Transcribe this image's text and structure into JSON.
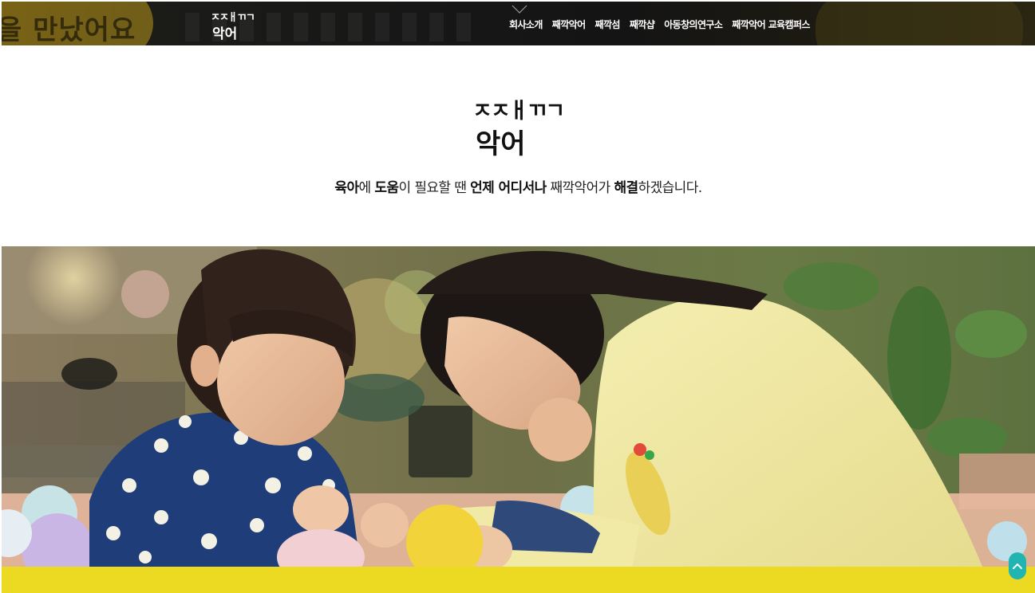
{
  "header": {
    "background_text": "을 만났어요",
    "logo": {
      "line1": "ㅈㅈㅐㄲㄱ",
      "line2": "악어"
    },
    "nav": [
      {
        "label": "회사소개"
      },
      {
        "label": "째깍악어"
      },
      {
        "label": "째깍섬"
      },
      {
        "label": "째깍샵"
      },
      {
        "label": "아동창의연구소"
      },
      {
        "label": "째깍악어 교육캠퍼스"
      }
    ]
  },
  "intro": {
    "logo": {
      "line1": "ㅈㅈㅐㄲㄱ",
      "line2": "악어"
    },
    "tagline": [
      {
        "text": "육아",
        "bold": true
      },
      {
        "text": "에 ",
        "bold": false
      },
      {
        "text": "도움",
        "bold": true
      },
      {
        "text": "이 필요할 땐 ",
        "bold": false
      },
      {
        "text": "언제 어디서나",
        "bold": true
      },
      {
        "text": " 째깍악어가 ",
        "bold": false
      },
      {
        "text": "해결",
        "bold": true
      },
      {
        "text": "하겠습니다.",
        "bold": false
      }
    ]
  },
  "hero": {
    "icon": "photo-mother-and-child"
  },
  "colors": {
    "band": "#ecd922",
    "top_button": "#20b5b0",
    "header": "#171717"
  },
  "controls": {
    "top_button_icon": "chevron-up-icon"
  }
}
